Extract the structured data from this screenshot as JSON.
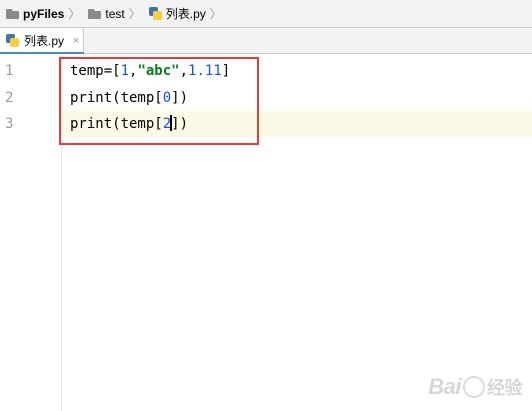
{
  "colors": {
    "folder": "#8a8a8a",
    "crumb_separator": "#a0a0a0",
    "highlight_border": "#e53d3d",
    "current_line": "#fcfae6",
    "keyword_number": "#1750eb",
    "string": "#067d17",
    "line_number": "#999999",
    "tab_underline": "#4a88c7"
  },
  "breadcrumb": {
    "items": [
      {
        "label": "pyFiles",
        "icon": "folder-icon"
      },
      {
        "label": "test",
        "icon": "folder-icon"
      },
      {
        "label": "列表.py",
        "icon": "python-file-icon"
      }
    ],
    "separator": "〉"
  },
  "tabs": [
    {
      "label": "列表.py",
      "icon": "python-file-icon",
      "close": "×"
    }
  ],
  "editor": {
    "line_numbers": [
      "1",
      "2",
      "3"
    ],
    "lines": [
      {
        "parts": [
          "temp=[",
          "1",
          ",",
          "\"abc\"",
          ",",
          "1.11",
          "]"
        ]
      },
      {
        "parts": [
          "print(temp[",
          "0",
          "])"
        ]
      },
      {
        "parts": [
          "print(temp[",
          "2",
          "])"
        ]
      }
    ]
  },
  "watermark": {
    "text": "Bai",
    "text2": "经验"
  }
}
